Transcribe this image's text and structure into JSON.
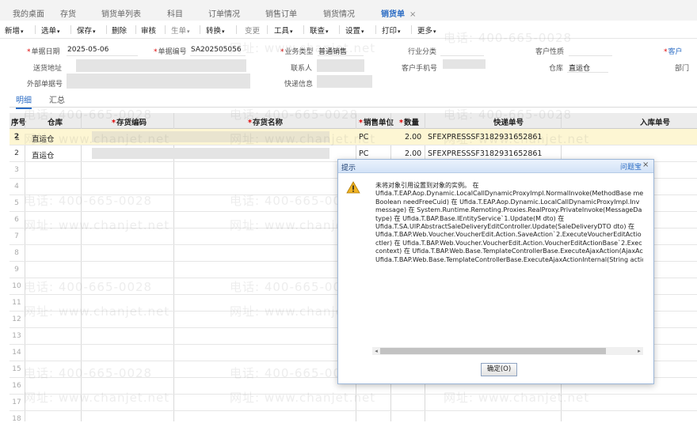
{
  "tabs": [
    {
      "label": "我的桌面"
    },
    {
      "label": "存货"
    },
    {
      "label": "销货单列表"
    },
    {
      "label": "科目"
    },
    {
      "label": "订单情况"
    },
    {
      "label": "销售订单"
    },
    {
      "label": "销货情况"
    },
    {
      "label": "销货单",
      "active": true,
      "close": "×"
    }
  ],
  "toolbar": {
    "new": "新增",
    "select_order": "选单",
    "save": "保存",
    "delete": "删除",
    "audit": "审核",
    "generate": "生单",
    "convert": "转换",
    "change": "变更",
    "tools": "工具",
    "query": "联查",
    "settings": "设置",
    "print": "打印",
    "more": "更多"
  },
  "form": {
    "doc_date_label": "单据日期",
    "doc_date": "2025-05-06",
    "doc_no_label": "单据编号",
    "doc_no": "SA202505056",
    "biz_type_label": "业务类型",
    "biz_type": "普通销售",
    "industry_label": "行业分类",
    "cust_nature_label": "客户性质",
    "customer_label": "客户",
    "ship_addr_label": "送货地址",
    "contact_label": "联系人",
    "cust_phone_label": "客户手机号",
    "warehouse_label": "仓库",
    "warehouse": "直运仓",
    "dept_label": "部门",
    "ext_no_label": "外部单据号",
    "express_label": "快递信息"
  },
  "subtabs": {
    "detail": "明细",
    "summary": "汇总"
  },
  "grid": {
    "headers": {
      "seq": "序号",
      "warehouse": "仓库",
      "code": "存货编码",
      "name": "存货名称",
      "unit": "销售单位",
      "qty": "数量",
      "tracking": "快递单号",
      "inbound": "入库单号"
    },
    "rows": [
      {
        "seq": "2̲",
        "warehouse": "直运仓",
        "unit": "PC",
        "qty": "2.00",
        "tracking": "SFEXPRESSSF3182931652861"
      },
      {
        "seq": "2",
        "warehouse": "直运仓",
        "unit": "PC",
        "qty": "2.00",
        "tracking": "SFEXPRESSSF3182931652861"
      }
    ],
    "empty_rows": [
      "3",
      "4",
      "5",
      "6",
      "7",
      "8",
      "9",
      "10",
      "11",
      "12",
      "13",
      "14",
      "15",
      "16",
      "17",
      "18"
    ]
  },
  "dialog": {
    "title": "提示",
    "help": "问题宝",
    "close": "×",
    "message_lines": [
      "未将对象引用设置到对象的实例。 在",
      "Ufida.T.EAP.Aop.Dynamic.LocalCallDynamicProxyImpl.NormalInvoke(MethodBase me",
      "Boolean needFreeCuid) 在 Ufida.T.EAP.Aop.Dynamic.LocalCallDynamicProxyImpl.Inv",
      "message) 在 System.Runtime.Remoting.Proxies.RealProxy.PrivateInvoke(MessageDa",
      "type) 在 Ufida.T.BAP.Base.IEntityService`1.Update(M dto) 在",
      "Ufida.T.SA.UIP.AbstractSaleDeliveryEditController.Update(SaleDeliveryDTO dto) 在",
      "Ufida.T.BAP.Web.Voucher.VoucherEdit.Action.SaveAction`2.ExecuteVoucherEditActio",
      "ctler) 在 Ufida.T.BAP.Web.Voucher.VoucherEdit.Action.VoucherEditActionBase`2.Exec",
      "context) 在 Ufida.T.BAP.Web.Base.TemplateControllerBase.ExecuteAjaxAction(AjaxAc",
      "Ufida.T.BAP.Web.Base.TemplateControllerBase.ExecuteAjaxActionInternal(String actio"
    ],
    "ok": "确定(O)"
  },
  "watermark": {
    "phone": "电话: 400-665-0028",
    "site": "网址: www.chanjet.net"
  },
  "icons": {
    "warning": "warning-icon"
  },
  "colors": {
    "accent": "#2b6cc4",
    "selected_row": "#fdf6d3",
    "warning": "#f0b323"
  }
}
